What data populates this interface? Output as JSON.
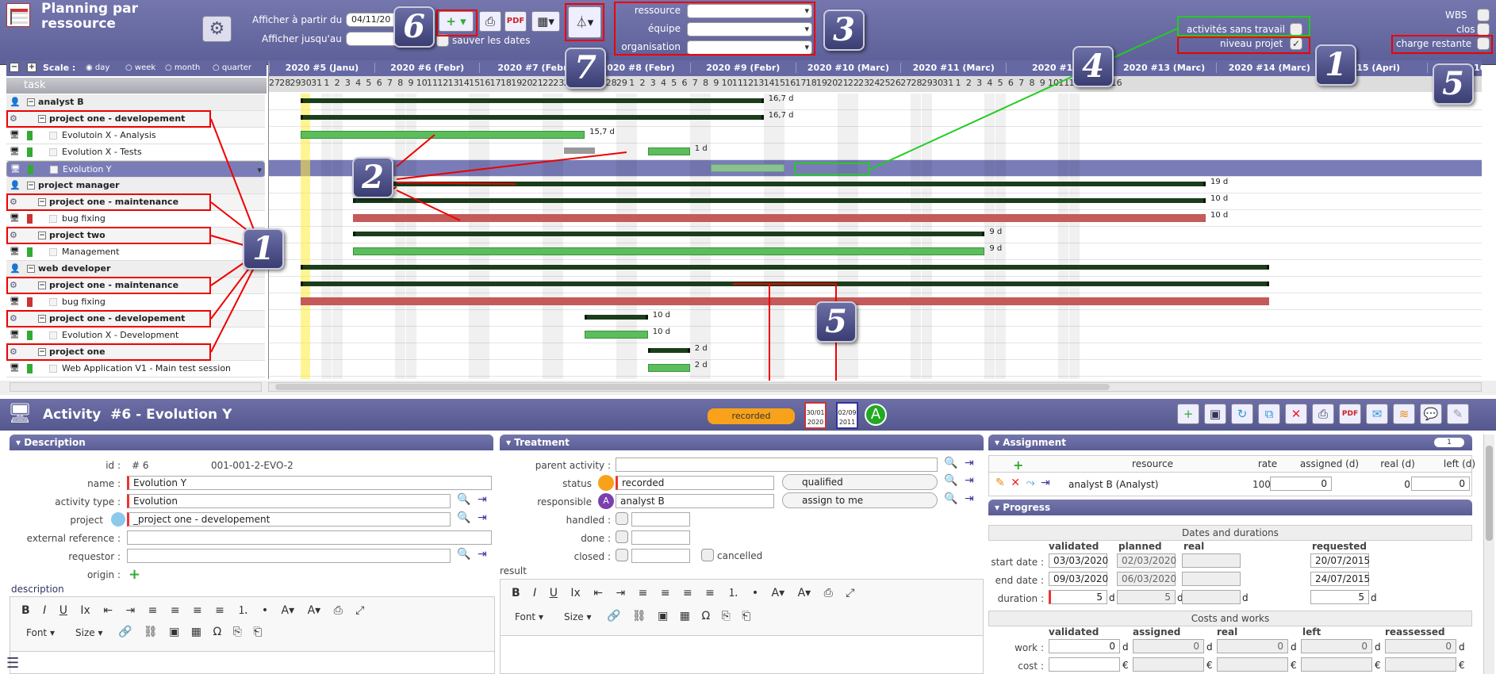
{
  "window": {
    "title": "Planning par ressource"
  },
  "toolbar": {
    "from_label": "Afficher à partir du",
    "from_value": "04/11/20",
    "until_label": "Afficher jusqu'au",
    "until_value": "",
    "save_dates_label": "sauver les dates",
    "ressource_label": "ressource",
    "equipe_label": "équipe",
    "organisation_label": "organisation",
    "activites_sans_travail_label": "activités sans travail",
    "niveau_projet_label": "niveau projet",
    "wbs_label": "WBS",
    "clos_label": "clos",
    "charge_restante_label": "charge restante"
  },
  "scale": {
    "label": "Scale :",
    "options": [
      "day",
      "week",
      "month",
      "quarter"
    ],
    "selected": "day"
  },
  "task_header": "task",
  "weeks": [
    "2020 #5 (Janu)",
    "2020 #6 (Febr)",
    "2020 #7 (Febr",
    "2020 #8 (Febr)",
    "2020 #9 (Febr)",
    "2020 #10 (Marc)",
    "2020 #11 (Marc)",
    "2020 #12 (",
    "2020 #13 (Marc)",
    "2020 #14 (Marc)",
    "#15 (Apri)",
    "16"
  ],
  "days": [
    "27",
    "28",
    "29",
    "30",
    "31",
    "1",
    "2",
    "3",
    "4",
    "5",
    "6",
    "7",
    "8",
    "9",
    "10",
    "11",
    "12",
    "13",
    "14",
    "15",
    "16",
    "17",
    "18",
    "19",
    "20",
    "21",
    "22",
    "23",
    "24",
    "25",
    "26",
    "27",
    "28",
    "29",
    "1",
    "2",
    "3",
    "4",
    "5",
    "6",
    "7",
    "8",
    "9",
    "10",
    "11",
    "12",
    "13",
    "14",
    "15",
    "16",
    "17",
    "18",
    "19",
    "20",
    "21",
    "22",
    "23",
    "24",
    "25",
    "26",
    "27",
    "28",
    "29",
    "30",
    "31",
    "1",
    "2",
    "3",
    "4",
    "5",
    "6",
    "7",
    "8",
    "9",
    "10",
    "11",
    "12",
    "13",
    "14",
    "15",
    "16"
  ],
  "tasks": [
    {
      "type": "res",
      "name": "analyst B"
    },
    {
      "type": "proj",
      "name": "project one - developement"
    },
    {
      "type": "act",
      "name": "Evolutoin X - Analysis",
      "color": "#3a3"
    },
    {
      "type": "act",
      "name": "Evolution X - Tests",
      "color": "#3a3"
    },
    {
      "type": "act",
      "name": "Evolution Y",
      "color": "#3a3",
      "selected": true
    },
    {
      "type": "res",
      "name": "project manager"
    },
    {
      "type": "proj",
      "name": "project one - maintenance"
    },
    {
      "type": "act",
      "name": "bug fixing",
      "color": "#c33"
    },
    {
      "type": "proj",
      "name": "project two"
    },
    {
      "type": "act",
      "name": "Management",
      "color": "#3a3"
    },
    {
      "type": "res",
      "name": "web developer"
    },
    {
      "type": "proj",
      "name": "project one - maintenance"
    },
    {
      "type": "act",
      "name": "bug fixing",
      "color": "#c33"
    },
    {
      "type": "proj",
      "name": "project one - developement"
    },
    {
      "type": "act",
      "name": "Evolution X - Development",
      "color": "#3a3"
    },
    {
      "type": "proj",
      "name": "project one"
    },
    {
      "type": "act",
      "name": "Web Application V1 - Main test session",
      "color": "#3a3"
    }
  ],
  "bar_labels": [
    "16,7 d",
    "16,7 d",
    "15,7 d",
    "1 d",
    "19 d",
    "10 d",
    "10 d",
    "9 d",
    "9 d",
    "10 d",
    "10 d",
    "2 d",
    "2 d"
  ],
  "badges": [
    "6",
    "3",
    "7",
    "4",
    "1",
    "5",
    "2",
    "1",
    "5"
  ],
  "activity": {
    "title": "Activity  #6 - Evolution Y",
    "status_badge": "recorded",
    "date1_top": "30/01",
    "date1_bottom": "2020",
    "date2_top": "02/09",
    "date2_bottom": "2011",
    "avatar_letter": "A"
  },
  "description": {
    "header": "Description",
    "id_label": "id :",
    "id_value": "#  6",
    "id_code": "001-001-2-EVO-2",
    "name_label": "name :",
    "name_value": "Evolution Y",
    "type_label": "activity type :",
    "type_value": "Evolution",
    "project_label": "project",
    "project_value": "_project one - developement",
    "extref_label": "external reference :",
    "extref_value": "",
    "requestor_label": "requestor :",
    "requestor_value": "",
    "origin_label": "origin :",
    "description_label": "description",
    "font_label": "Font",
    "size_label": "Size"
  },
  "treatment": {
    "header": "Treatment",
    "parent_label": "parent activity :",
    "parent_value": "",
    "status_label": "status",
    "status_value": "recorded",
    "qualified_label": "qualified",
    "responsible_label": "responsible",
    "responsible_value": "analyst B",
    "assign_label": "assign to me",
    "handled_label": "handled :",
    "done_label": "done :",
    "closed_label": "closed :",
    "cancelled_label": "cancelled",
    "result_label": "result",
    "font_label": "Font",
    "size_label": "Size"
  },
  "assignment": {
    "header": "Assignment",
    "count": "1",
    "columns": [
      "resource",
      "rate",
      "assigned (d)",
      "real (d)",
      "left (d)"
    ],
    "rows": [
      {
        "resource": "analyst B (Analyst)",
        "rate": "100 %",
        "assigned": "0",
        "real": "0,00",
        "left": "0"
      }
    ]
  },
  "progress": {
    "header": "Progress",
    "dates_title": "Dates and durations",
    "cols": [
      "validated",
      "planned",
      "real",
      "requested"
    ],
    "start_label": "start date :",
    "start_validated": "03/03/2020",
    "start_planned": "02/03/2020",
    "start_requested": "20/07/2015",
    "end_label": "end date :",
    "end_validated": "09/03/2020",
    "end_planned": "06/03/2020",
    "end_requested": "24/07/2015",
    "duration_label": "duration :",
    "dur_validated": "5",
    "dur_planned": "5",
    "dur_requested": "5",
    "unit_d": "d",
    "costs_title": "Costs and works",
    "cw_cols": [
      "validated",
      "assigned",
      "real",
      "left",
      "reassessed"
    ],
    "work_label": "work :",
    "work_values": [
      "0",
      "0",
      "0",
      "0",
      "0"
    ],
    "cost_label": "cost :",
    "currency": "€"
  }
}
